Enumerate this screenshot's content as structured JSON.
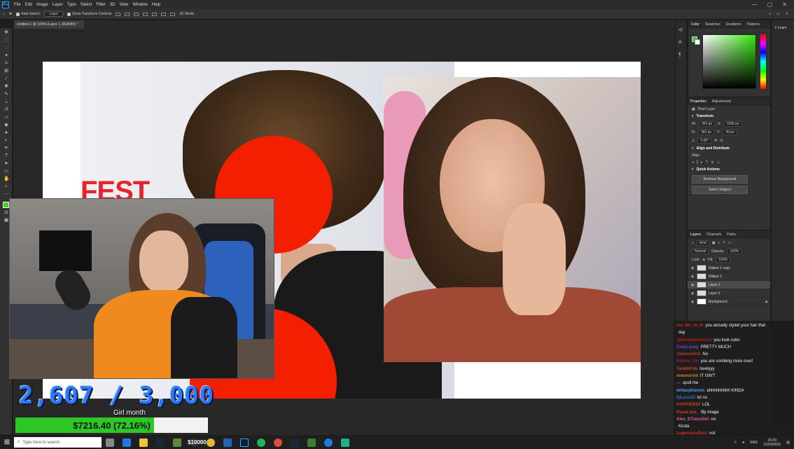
{
  "app": {
    "logo": "Ps",
    "menu": [
      "File",
      "Edit",
      "Image",
      "Layer",
      "Type",
      "Select",
      "Filter",
      "3D",
      "View",
      "Window",
      "Help"
    ],
    "window_controls": [
      "—",
      "▢",
      "✕"
    ]
  },
  "options_bar": {
    "auto_select_label": "Auto-Select:",
    "auto_select_value": "Layer",
    "show_transform_label": "Show Transform Controls",
    "mode_3d_label": "3D Mode:"
  },
  "document": {
    "tab_title": "Untitled-1 @ 100% (Layer 1, RGB/8#) *",
    "canvas_text": "FEST"
  },
  "color_panel": {
    "tabs": [
      "Color",
      "Swatches",
      "Gradients",
      "Patterns"
    ],
    "fg_color": "#2fd71b",
    "bg_color": "#ffffff"
  },
  "properties_panel": {
    "tabs": [
      "Properties",
      "Adjustments"
    ],
    "layer_type": "Pixel Layer",
    "transform_label": "Transform",
    "w_label": "W:",
    "w_value": "362 px",
    "x_label": "X:",
    "x_value": "1095 px",
    "h_label": "H:",
    "h_value": "362 px",
    "y_label": "Y:",
    "y_value": "49 px",
    "angle_value": "0.00°",
    "align_label": "Align and Distribute",
    "align_sub": "Align:",
    "quick_actions_label": "Quick Actions",
    "remove_bg_button": "Remove Background",
    "select_subject_button": "Select Subject"
  },
  "layers_panel": {
    "tabs": [
      "Layers",
      "Channels",
      "Paths"
    ],
    "kind_filter": "Kind",
    "blend_mode": "Normal",
    "opacity_label": "Opacity:",
    "opacity_value": "100%",
    "lock_label": "Lock:",
    "fill_label": "Fill:",
    "fill_value": "100%",
    "layers": [
      {
        "name": "Ellipse 1 copy",
        "selected": false
      },
      {
        "name": "Ellipse 1",
        "selected": false
      },
      {
        "name": "Layer 1",
        "selected": true
      },
      {
        "name": "Layer 2",
        "selected": false
      },
      {
        "name": "Background",
        "selected": false
      }
    ]
  },
  "far_right_panel": {
    "learn_label": "Learn"
  },
  "stream_overlay": {
    "counter": "2,607 / 3,000",
    "goal_label": "Girl month",
    "progress_text": "$7216.40 (72.16%)",
    "progress_fraction": 0.7216,
    "progress_color": "#2ec826",
    "goal_amount": "$10000"
  },
  "chat": [
    {
      "user": "ma_dm_m_m",
      "color": "#e0241b",
      "text": "you actually styled your hair that"
    },
    {
      "user": "",
      "color": "#ffffff",
      "text": "day"
    },
    {
      "user": "sphimmisomiscal",
      "color": "#c21a1a",
      "text": "you look cuter"
    },
    {
      "user": "ZoeyLoseg",
      "color": "#7a3fd1",
      "text": "PRETTY MUCH"
    },
    {
      "user": "Julianvelin3",
      "color": "#c0392b",
      "text": "No"
    },
    {
      "user": "Hallow_tim",
      "color": "#b2122e",
      "text": "you are combing more over!"
    },
    {
      "user": "TaraN47ds",
      "color": "#d1451f",
      "text": "lovelyyy"
    },
    {
      "user": "mnemoriot",
      "color": "#e07a1b",
      "text": "IT ISN'T"
    },
    {
      "user": "—",
      "color": "#3a7bd5",
      "text": "spoil me"
    },
    {
      "user": "deltavphoenix",
      "color": "#4aa3df",
      "text": "ahhhhhhhhh KINDA"
    },
    {
      "user": "DjLoss23",
      "color": "#3d6fd1",
      "text": "lol no"
    },
    {
      "user": "HARRIER80",
      "color": "#c0392b",
      "text": "LOL"
    },
    {
      "user": "OyaaLove_",
      "color": "#d33a2c",
      "text": "flip image"
    },
    {
      "user": "Alex_ETransGirl",
      "color": "#e25aa0",
      "text": "no"
    },
    {
      "user": "",
      "color": "#ffffff",
      "text": "Kinda"
    },
    {
      "user": "LegendaryRazz",
      "color": "#d12b2b",
      "text": "not"
    }
  ],
  "taskbar": {
    "search_placeholder": "Type here to search",
    "language": "ENG",
    "time": "20:29",
    "date": "21/03/2021",
    "icons": [
      "task-view",
      "edge",
      "explorer",
      "steam",
      "minecraft",
      "obs",
      "chrome-canary",
      "vs-code",
      "photoshop",
      "spotify",
      "chrome",
      "steam-2",
      "terraria",
      "edge-2",
      "game"
    ]
  }
}
